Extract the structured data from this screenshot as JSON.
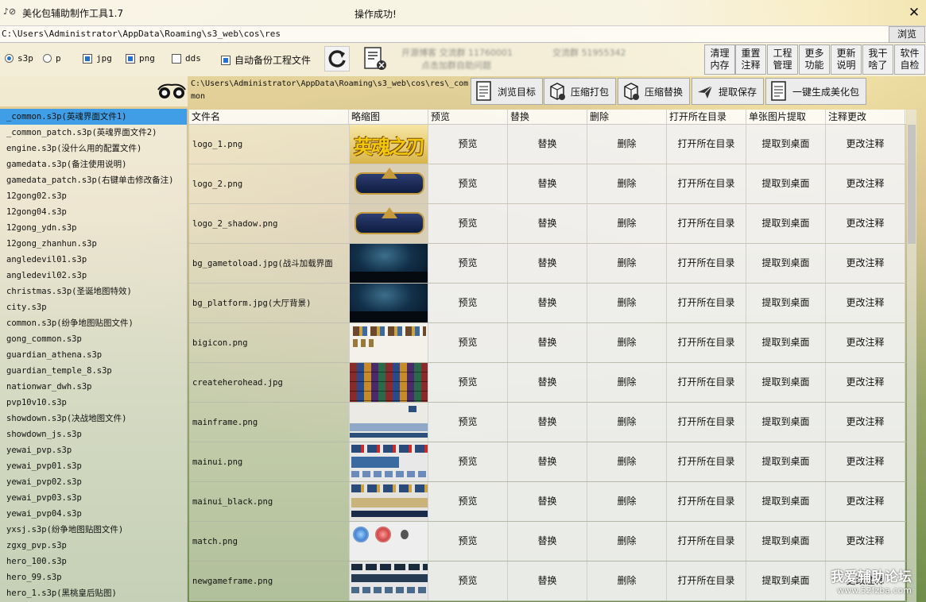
{
  "window": {
    "title": "美化包辅助制作工具1.7",
    "status": "操作成功!",
    "close": "✕"
  },
  "pathbar": {
    "path": "C:\\Users\\Administrator\\AppData\\Roaming\\s3_web\\cos\\res",
    "browse": "浏览"
  },
  "options": {
    "s3p": "s3p",
    "p": "p",
    "jpg": "jpg",
    "png": "png",
    "dds": "dds",
    "auto_backup": "自动备份工程文件",
    "blurred_line1": "开源博客 交流群 11760001",
    "blurred_line2": "点击加群自助问题",
    "blurred_line3": "交流群 51955342"
  },
  "right_buttons": [
    {
      "line1": "清理",
      "line2": "内存"
    },
    {
      "line1": "重置",
      "line2": "注释"
    },
    {
      "line1": "工程",
      "line2": "管理"
    },
    {
      "line1": "更多",
      "line2": "功能"
    },
    {
      "line1": "更新",
      "line2": "说明"
    },
    {
      "line1": "我干",
      "line2": "啥了"
    },
    {
      "line1": "软件",
      "line2": "自检"
    }
  ],
  "toolbar": {
    "subpath": "C:\\Users\\Administrator\\AppData\\Roaming\\s3_web\\cos\\res\\_common",
    "browse_target": "浏览目标",
    "compress_pack": "压缩打包",
    "compress_replace": "压缩替换",
    "extract_save": "提取保存",
    "one_click": "一键生成美化包"
  },
  "files": [
    "_common.s3p(英魂界面文件1)",
    "_common_patch.s3p(英魂界面文件2)",
    "engine.s3p(没什么用的配置文件)",
    "gamedata.s3p(备注使用说明)",
    "gamedata_patch.s3p(右键单击修改备注)",
    "12gong02.s3p",
    "12gong04.s3p",
    "12gong_ydn.s3p",
    "12gong_zhanhun.s3p",
    "angledevil01.s3p",
    "angledevil02.s3p",
    "christmas.s3p(圣诞地图特效)",
    "city.s3p",
    "common.s3p(纷争地图贴图文件)",
    "gong_common.s3p",
    "guardian_athena.s3p",
    "guardian_temple_8.s3p",
    "nationwar_dwh.s3p",
    "pvp10v10.s3p",
    "showdown.s3p(决战地图文件)",
    "showdown_js.s3p",
    "yewai_pvp.s3p",
    "yewai_pvp01.s3p",
    "yewai_pvp02.s3p",
    "yewai_pvp03.s3p",
    "yewai_pvp04.s3p",
    "yxsj.s3p(纷争地图贴图文件)",
    "zgxg_pvp.s3p",
    "hero_100.s3p",
    "hero_99.s3p",
    "hero_1.s3p(黑桃皇后贴图)"
  ],
  "grid": {
    "headers": [
      "文件名",
      "略缩图",
      "预览",
      "替换",
      "删除",
      "打开所在目录",
      "单张图片提取",
      "注释更改"
    ],
    "actions": {
      "preview": "预览",
      "replace": "替换",
      "delete": "删除",
      "open_dir": "打开所在目录",
      "extract": "提取到桌面",
      "edit_note": "更改注释"
    },
    "rows": [
      {
        "name": "logo_1.png",
        "thumb": "logo-gold-text",
        "thumb_text": "英魂之刃"
      },
      {
        "name": "logo_2.png",
        "thumb": "logo-emblem",
        "thumb_text": ""
      },
      {
        "name": "logo_2_shadow.png",
        "thumb": "logo-emblem",
        "thumb_text": ""
      },
      {
        "name": "bg_gametoload.jpg(战斗加载界面",
        "thumb": "night-scene",
        "thumb_text": ""
      },
      {
        "name": "bg_platform.jpg(大厅背景)",
        "thumb": "night-scene",
        "thumb_text": ""
      },
      {
        "name": "bigicon.png",
        "thumb": "icon-sheet",
        "thumb_text": ""
      },
      {
        "name": "createherohead.jpg",
        "thumb": "hero-heads",
        "thumb_text": ""
      },
      {
        "name": "mainframe.png",
        "thumb": "ui-frame",
        "thumb_text": ""
      },
      {
        "name": "mainui.png",
        "thumb": "ui-sheet",
        "thumb_text": ""
      },
      {
        "name": "mainui_black.png",
        "thumb": "ui-sheet-black",
        "thumb_text": ""
      },
      {
        "name": "match.png",
        "thumb": "match-circles",
        "thumb_text": ""
      },
      {
        "name": "newgameframe.png",
        "thumb": "ui-frame-dark",
        "thumb_text": ""
      }
    ]
  },
  "watermark": {
    "line1": "我爱辅助论坛",
    "line2": "www.52fzba.com"
  }
}
